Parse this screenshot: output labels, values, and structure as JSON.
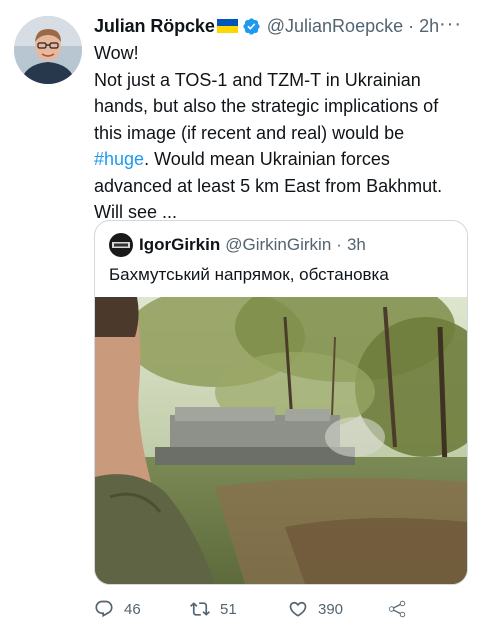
{
  "tweet": {
    "author_name": "Julian Röpcke",
    "author_flag_icon": "ukraine-flag-icon",
    "verified_icon": "verified-badge-icon",
    "handle": "@JulianRoepcke",
    "separator": "·",
    "time": "2h",
    "more_icon": "more-dots-icon",
    "more_label": "···",
    "text_lines": [
      "Wow!",
      "Not just a TOS-1 and TZM-T in Ukrainian",
      "hands, but also the strategic implications of",
      "this image (if recent and real) would be",
      "advanced at least 5 km East from Bakhmut.",
      "Will see ..."
    ],
    "hashtag": "#huge",
    "after_hashtag": ". Would mean Ukrainian forces"
  },
  "quoted_tweet": {
    "author_name": "IgorGirkin",
    "handle": "@GirkinGirkin",
    "separator": "·",
    "time": "3h",
    "text": "Бахмутський напрямок, обстановка",
    "media_description_icon": "video-thumbnail-image"
  },
  "actions": {
    "reply_count": "46",
    "retweet_count": "51",
    "like_count": "390",
    "reply_icon": "reply-icon",
    "retweet_icon": "retweet-icon",
    "like_icon": "heart-icon",
    "share_icon": "share-icon"
  },
  "colors": {
    "link": "#1d9bf0",
    "secondary_text": "#536471",
    "border": "#cfd9de"
  }
}
